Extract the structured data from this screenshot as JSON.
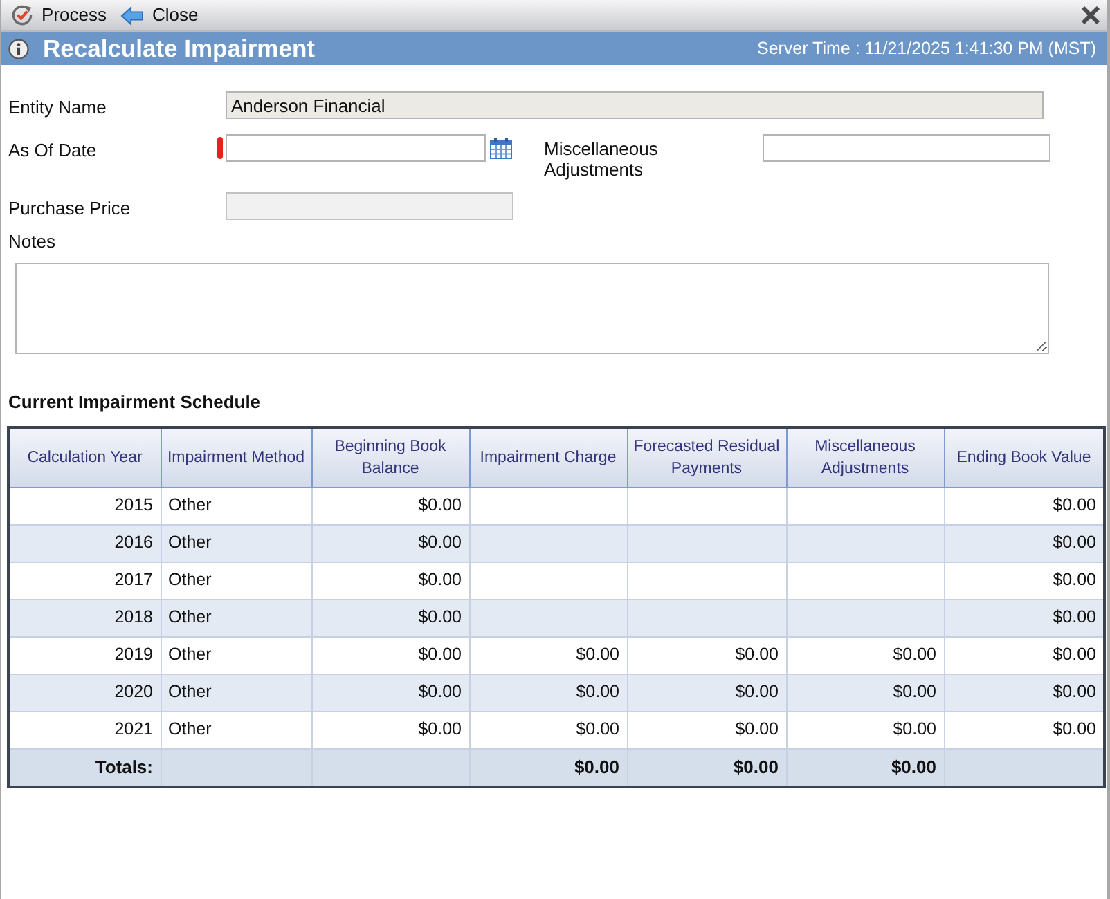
{
  "toolbar": {
    "buttons": [
      {
        "kind": "process",
        "label": "Process"
      },
      {
        "kind": "back",
        "label": "Close"
      }
    ]
  },
  "title_bar": {
    "title": "Recalculate Impairment",
    "server_time": "Server Time : 11/21/2025 1:41:30 PM (MST)"
  },
  "form": {
    "entity_name": {
      "label": "Entity Name",
      "value": "Anderson Financial",
      "readonly": true
    },
    "as_of_date": {
      "label": "As Of Date",
      "required": true
    },
    "miscellaneous_adjustments": {
      "label": "Miscellaneous Adjustments"
    },
    "purchase_price": {
      "label": "Purchase Price",
      "disabled": true
    },
    "notes": {
      "label": "Notes"
    }
  },
  "schedule": {
    "title": "Current Impairment Schedule",
    "columns": [
      "Calculation Year",
      "Impairment Method",
      "Beginning Book Balance",
      "Impairment Charge",
      "Forecasted Residual Payments",
      "Miscellaneous Adjustments",
      "Ending Book Value"
    ],
    "rows": [
      {
        "calculation_year": "2015",
        "impairment_method": "Other",
        "beginning_book_balance": "$0.00",
        "ending_book_value": "$0.00"
      },
      {
        "calculation_year": "2016",
        "impairment_method": "Other",
        "beginning_book_balance": "$0.00",
        "ending_book_value": "$0.00"
      },
      {
        "calculation_year": "2017",
        "impairment_method": "Other",
        "beginning_book_balance": "$0.00",
        "ending_book_value": "$0.00"
      },
      {
        "calculation_year": "2018",
        "impairment_method": "Other",
        "beginning_book_balance": "$0.00",
        "ending_book_value": "$0.00"
      },
      {
        "calculation_year": "2019",
        "impairment_method": "Other",
        "beginning_book_balance": "$0.00",
        "impairment_charge": "$0.00",
        "forecasted_residual_payments": "$0.00",
        "miscellaneous_adjustments": "$0.00",
        "ending_book_value": "$0.00"
      },
      {
        "calculation_year": "2020",
        "impairment_method": "Other",
        "beginning_book_balance": "$0.00",
        "impairment_charge": "$0.00",
        "forecasted_residual_payments": "$0.00",
        "miscellaneous_adjustments": "$0.00",
        "ending_book_value": "$0.00"
      },
      {
        "calculation_year": "2021",
        "impairment_method": "Other",
        "beginning_book_balance": "$0.00",
        "impairment_charge": "$0.00",
        "forecasted_residual_payments": "$0.00",
        "miscellaneous_adjustments": "$0.00",
        "ending_book_value": "$0.00"
      }
    ],
    "totals": {
      "label": "Totals:",
      "impairment_charge": "$0.00",
      "forecasted_residual_payments": "$0.00",
      "miscellaneous_adjustments": "$0.00"
    }
  }
}
